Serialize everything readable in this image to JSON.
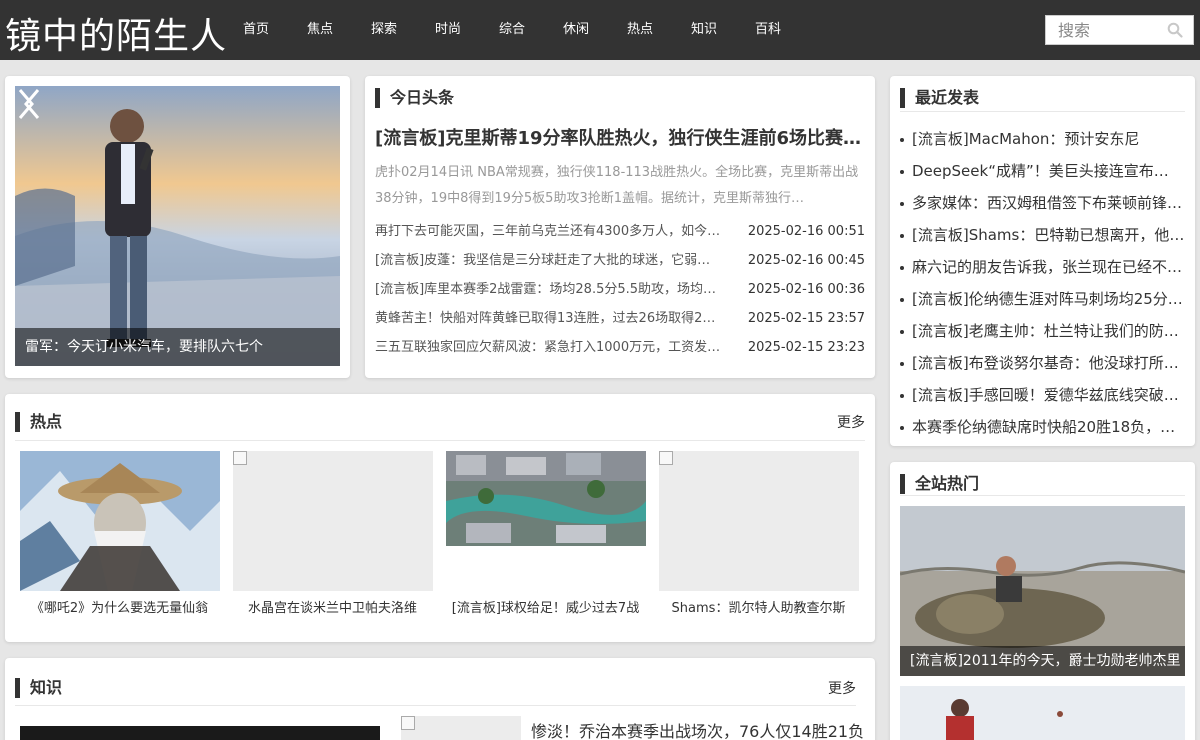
{
  "site": {
    "title": "镜中的陌生人"
  },
  "nav": [
    "首页",
    "焦点",
    "探索",
    "时尚",
    "综合",
    "休闲",
    "热点",
    "知识",
    "百科"
  ],
  "search": {
    "placeholder": "搜索"
  },
  "icons": {
    "search": "search-icon",
    "prev": "chevron-left-icon",
    "next": "chevron-right-icon"
  },
  "slider": {
    "caption": "雷军：今天订小米汽车，要排队六七个"
  },
  "headlines": {
    "title": "今日头条",
    "lead_title": "[流言板]克里斯蒂19分率队胜热火，独行侠生涯前6场比赛…",
    "lead_summary": "虎扑02月14日讯 NBA常规赛，独行侠118-113战胜热火。全场比赛，克里斯蒂出战38分钟，19中8得到19分5板5助攻3抢断1盖帽。据统计，克里斯蒂独行…",
    "items": [
      {
        "title": "再打下去可能灭国，三年前乌克兰还有4300多万人，如今…",
        "date": "2025-02-16 00:51"
      },
      {
        "title": "[流言板]皮蓬：我坚信是三分球赶走了大批的球迷，它弱…",
        "date": "2025-02-16 00:45"
      },
      {
        "title": "[流言板]库里本赛季2战雷霆：场均28.5分5.5助攻，场均…",
        "date": "2025-02-16 00:36"
      },
      {
        "title": "黄蜂苦主！快船对阵黄蜂已取得13连胜，过去26场取得2…",
        "date": "2025-02-15 23:57"
      },
      {
        "title": "三五互联独家回应欠薪风波：紧急打入1000万元，工资发…",
        "date": "2025-02-15 23:23"
      }
    ]
  },
  "hot": {
    "title": "热点",
    "more": "更多",
    "items": [
      {
        "caption": "《哪吒2》为什么要选无量仙翁"
      },
      {
        "caption": "水晶宫在谈米兰中卫帕夫洛维"
      },
      {
        "caption": "[流言板]球权给足！威少过去7战"
      },
      {
        "caption": "Shams：凯尔特人助教查尔斯"
      }
    ]
  },
  "knowledge": {
    "title": "知识",
    "more": "更多",
    "item": "惨淡！乔治本赛季出战场次，76人仅14胜21负"
  },
  "recent": {
    "title": "最近发表",
    "items": [
      "[流言板]MacMahon：预计安东尼",
      "DeepSeek“成精”！美巨头接连宣布…",
      "多家媒体：西汉姆租借签下布莱顿前锋…",
      "[流言板]Shams：巴特勒已想离开，他…",
      "麻六记的朋友告诉我，张兰现在已经不…",
      "[流言板]伦纳德生涯对阵马刺场均25分…",
      "[流言板]老鹰主帅：杜兰特让我们的防…",
      "[流言板]布登谈努尔基奇：他没球打所…",
      "[流言板]手感回暖！爱德华兹底线突破…",
      "本赛季伦纳德缺席时快船20胜18负，…"
    ]
  },
  "popular": {
    "title": "全站热门",
    "caption": "[流言板]2011年的今天，爵士功勋老帅杰里"
  }
}
